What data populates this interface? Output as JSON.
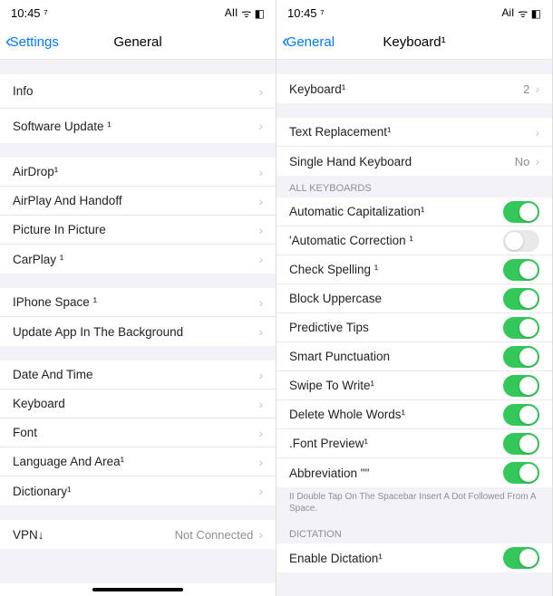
{
  "left": {
    "status": {
      "time": "10:45 ⁷",
      "signal": "AII",
      "icons": "ᯤ ◧"
    },
    "nav": {
      "back": "Settings",
      "title": "General"
    },
    "g1": [
      {
        "label": "Info"
      },
      {
        "label": "Software Update ¹"
      }
    ],
    "g2": [
      {
        "label": "AirDrop¹"
      },
      {
        "label": "AirPlay And Handoff"
      },
      {
        "label": "Picture In Picture"
      },
      {
        "label": "CarPlay ¹"
      }
    ],
    "g3": [
      {
        "label": "IPhone Space ¹"
      },
      {
        "label": "Update App In The Background"
      }
    ],
    "g4": [
      {
        "label": "Date And Time"
      },
      {
        "label": "Keyboard"
      },
      {
        "label": "Font"
      },
      {
        "label": "Language And Area¹"
      },
      {
        "label": "Dictionary¹"
      }
    ],
    "g5": [
      {
        "label": "VPN↓",
        "value": "Not Connected"
      }
    ]
  },
  "right": {
    "status": {
      "time": "10:45 ⁷",
      "signal": "AiI",
      "icons": "ᯤ ◧"
    },
    "nav": {
      "back": "General",
      "title": "Keyboard¹"
    },
    "g1": [
      {
        "label": "Keyboard¹",
        "value": "2"
      }
    ],
    "g2": [
      {
        "label": "Text Replacement¹"
      },
      {
        "label": "Single Hand Keyboard",
        "value": "No"
      }
    ],
    "section_all": "ALL KEYBOARDS",
    "toggles": [
      {
        "label": "Automatic Capitalization¹",
        "on": true
      },
      {
        "label": "'Automatic Correction ¹",
        "on": false
      },
      {
        "label": "Check Spelling ¹",
        "on": true
      },
      {
        "label": "Block Uppercase",
        "on": true
      },
      {
        "label": "Predictive Tips",
        "on": true
      },
      {
        "label": "Smart Punctuation",
        "on": true
      },
      {
        "label": "Swipe To Write¹",
        "on": true
      },
      {
        "label": "Delete Whole Words¹",
        "on": true
      },
      {
        "label": ".Font Preview¹",
        "on": true
      },
      {
        "label": "Abbreviation \"\"",
        "on": true
      }
    ],
    "footer1": "II Double Tap On The Spacebar Insert A Dot Followed From A Space.",
    "section_dict": "DICTATION",
    "dictation": {
      "label": "Enable Dictation¹",
      "on": true
    }
  }
}
